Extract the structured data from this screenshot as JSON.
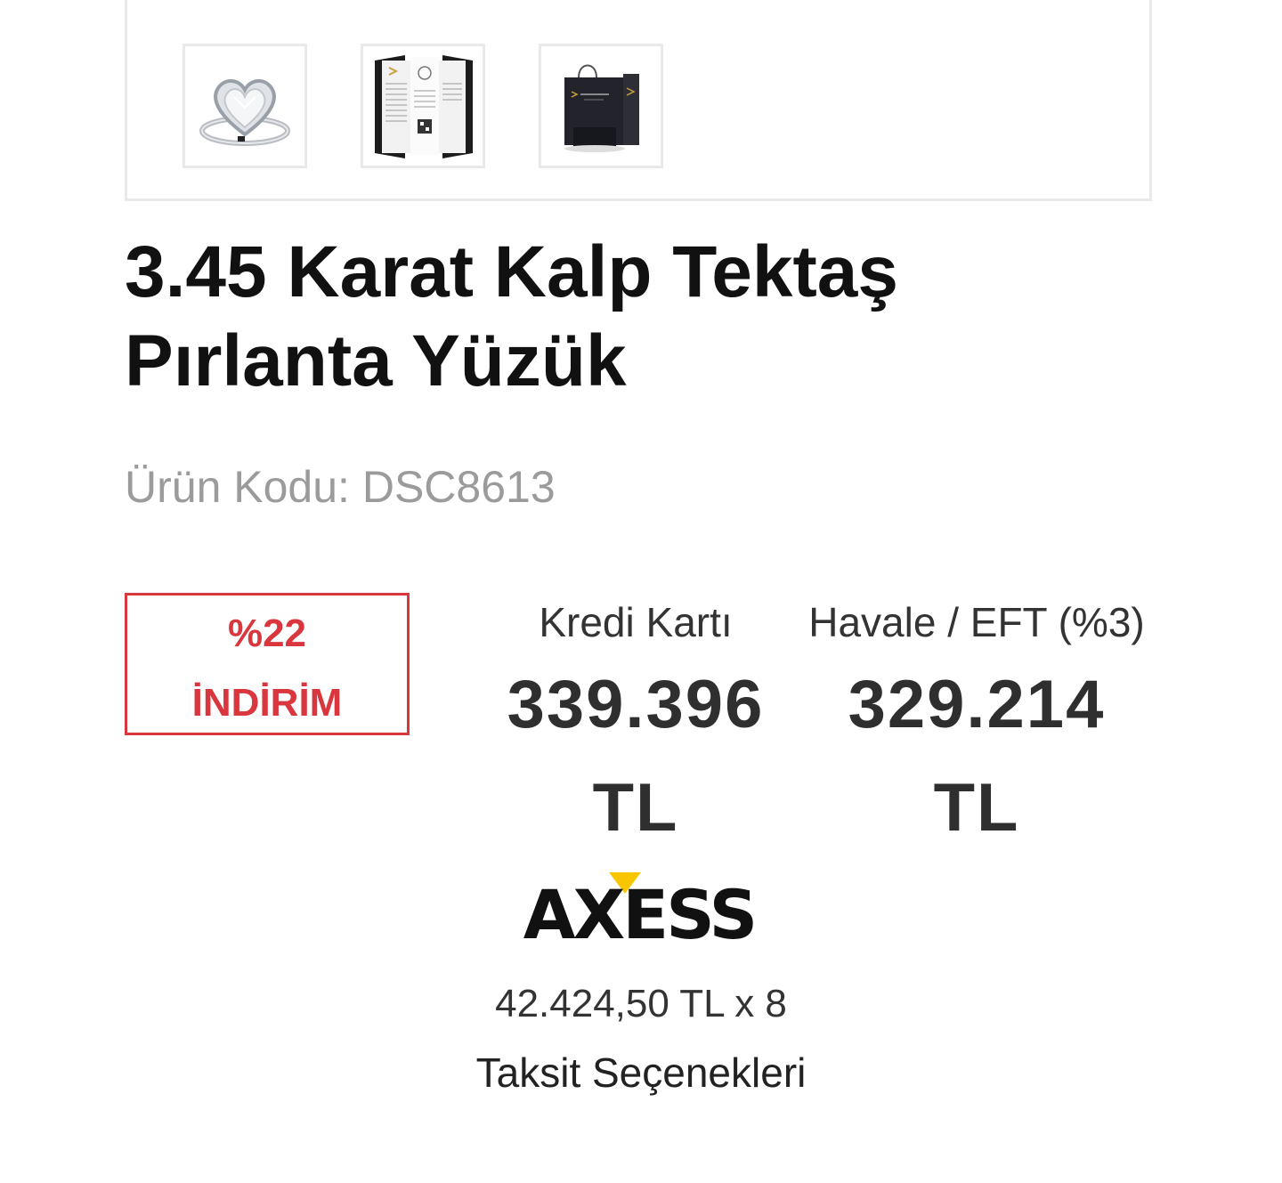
{
  "gallery": {
    "thumbnails": [
      {
        "icon": "ring-icon",
        "alt": ""
      },
      {
        "icon": "certificate-icon",
        "alt": ""
      },
      {
        "icon": "gift-box-icon",
        "alt": ""
      }
    ]
  },
  "product": {
    "title_line1": "3.45 Karat Kalp Tektaş",
    "title_line2": "Pırlanta Yüzük",
    "code_label": "Ürün Kodu:",
    "code_value": "DSC8613"
  },
  "discount": {
    "percent": "%22",
    "label": "İNDİRİM"
  },
  "prices": {
    "credit_card": {
      "label": "Kredi Kartı",
      "amount": "339.396",
      "currency": "TL"
    },
    "bank_transfer": {
      "label": "Havale / EFT (%3)",
      "amount": "329.214",
      "currency": "TL"
    }
  },
  "installments": {
    "bank_logo_text": "AXESS",
    "summary": "42.424,50 TL x 8",
    "link_label": "Taksit Seçenekleri"
  },
  "colors": {
    "discount_red": "#d9363e",
    "price_text": "#2f2f2f",
    "muted_text": "#9b9b9b",
    "border": "#e9e9e9",
    "axess_yellow": "#f7c600"
  }
}
